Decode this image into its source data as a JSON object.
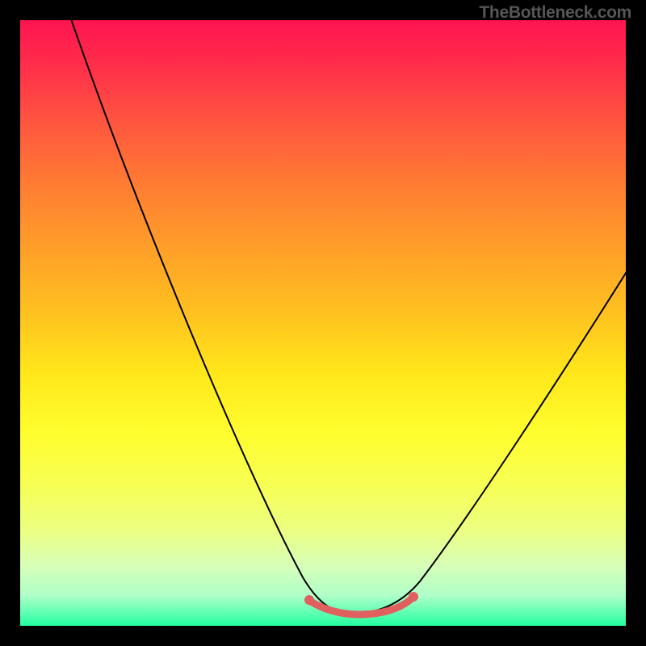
{
  "watermark": {
    "text": "TheBottleneck.com"
  },
  "chart_data": {
    "type": "line",
    "title": "",
    "xlabel": "",
    "ylabel": "",
    "x_range_normalized": [
      0,
      1
    ],
    "y_range_normalized": [
      0,
      1
    ],
    "description": "Bottleneck percentage curve over a vertical rainbow heatmap gradient. The black curve descends steeply from the upper-left, reaches a flat minimum near the bottom center (optimal zone, highlighted by a short salmon segment with end dots), then rises again toward the right. No numeric axis ticks or labels are rendered.",
    "series": [
      {
        "name": "bottleneck_curve_normalized",
        "x": [
          0.08,
          0.15,
          0.25,
          0.35,
          0.45,
          0.5,
          0.55,
          0.6,
          0.65,
          0.75,
          0.85,
          1.0
        ],
        "y": [
          1.0,
          0.8,
          0.55,
          0.3,
          0.08,
          0.02,
          0.02,
          0.03,
          0.07,
          0.25,
          0.45,
          0.6
        ]
      }
    ],
    "optimal_range_x_normalized": [
      0.48,
      0.65
    ],
    "background_gradient_stops": [
      {
        "pos": 0.0,
        "color": "#ff1450"
      },
      {
        "pos": 0.18,
        "color": "#ff5a3e"
      },
      {
        "pos": 0.38,
        "color": "#ffa028"
      },
      {
        "pos": 0.58,
        "color": "#ffe61a"
      },
      {
        "pos": 0.76,
        "color": "#f8ff50"
      },
      {
        "pos": 0.9,
        "color": "#d8ffb8"
      },
      {
        "pos": 1.0,
        "color": "#22ffa0"
      }
    ],
    "marker_color": "#e06060",
    "curve_color": "#000000"
  }
}
